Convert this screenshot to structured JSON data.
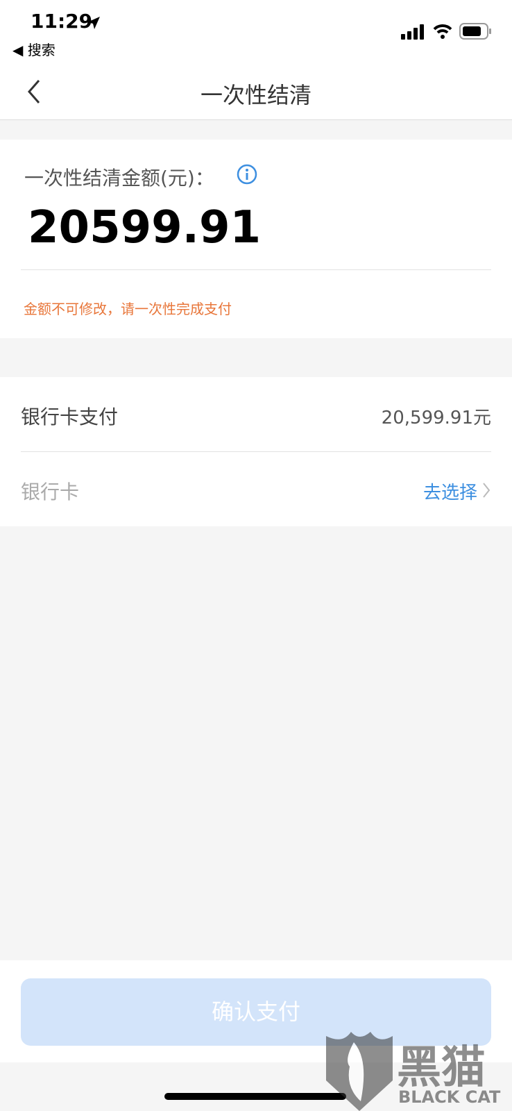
{
  "status_bar": {
    "time": "11:29",
    "back_app": "◀ 搜索"
  },
  "nav": {
    "title": "一次性结清"
  },
  "amount_card": {
    "label": "一次性结清金额(元)：",
    "amount": "20599.91",
    "warning": "金额不可修改，请一次性完成支付"
  },
  "payment": {
    "method_label": "银行卡支付",
    "method_value": "20,599.91元",
    "card_label": "银行卡",
    "card_action": "去选择"
  },
  "confirm_button": "确认支付",
  "watermark": {
    "text_cn": "黑猫",
    "text_en": "BLACK CAT"
  },
  "colors": {
    "accent": "#3d8fe0",
    "warning": "#e8763a",
    "button_disabled": "#d3e4fa"
  }
}
